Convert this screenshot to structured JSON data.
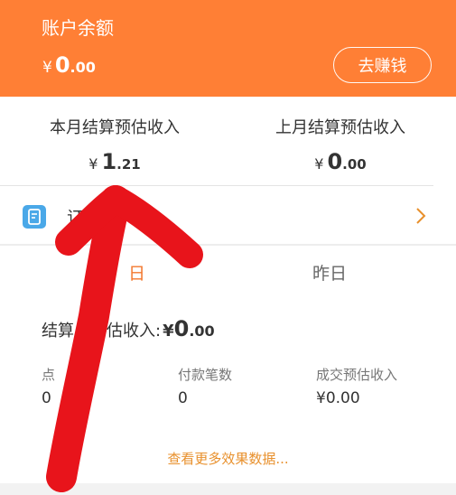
{
  "header": {
    "title": "账户余额",
    "balance": {
      "currency": "¥",
      "integer": "0",
      "decimal": ".00"
    },
    "earn_button": "去赚钱"
  },
  "stats": {
    "this_month": {
      "label": "本月结算预估收入",
      "currency": "¥",
      "integer": "1",
      "decimal": ".21"
    },
    "last_month": {
      "label": "上月结算预估收入",
      "currency": "¥",
      "integer": "0",
      "decimal": ".00"
    }
  },
  "orders": {
    "label": "订",
    "icon": "order-document-icon"
  },
  "tabs": {
    "today": "日",
    "yesterday": "昨日"
  },
  "settlement": {
    "label": "结算",
    "label_tail": "估收入:",
    "currency": "¥",
    "integer": "0",
    "decimal": ".00"
  },
  "metrics": [
    {
      "label": "点",
      "value": "0"
    },
    {
      "label": "付款笔数",
      "value": "0"
    },
    {
      "label": "成交预估收入",
      "value": "¥0.00"
    }
  ],
  "more_link": "查看更多效果数据...",
  "colors": {
    "header_bg": "#ff7f35",
    "accent": "#f3782f",
    "link": "#e8902c",
    "annotation": "#e8141b",
    "icon": "#4aa8e8"
  }
}
